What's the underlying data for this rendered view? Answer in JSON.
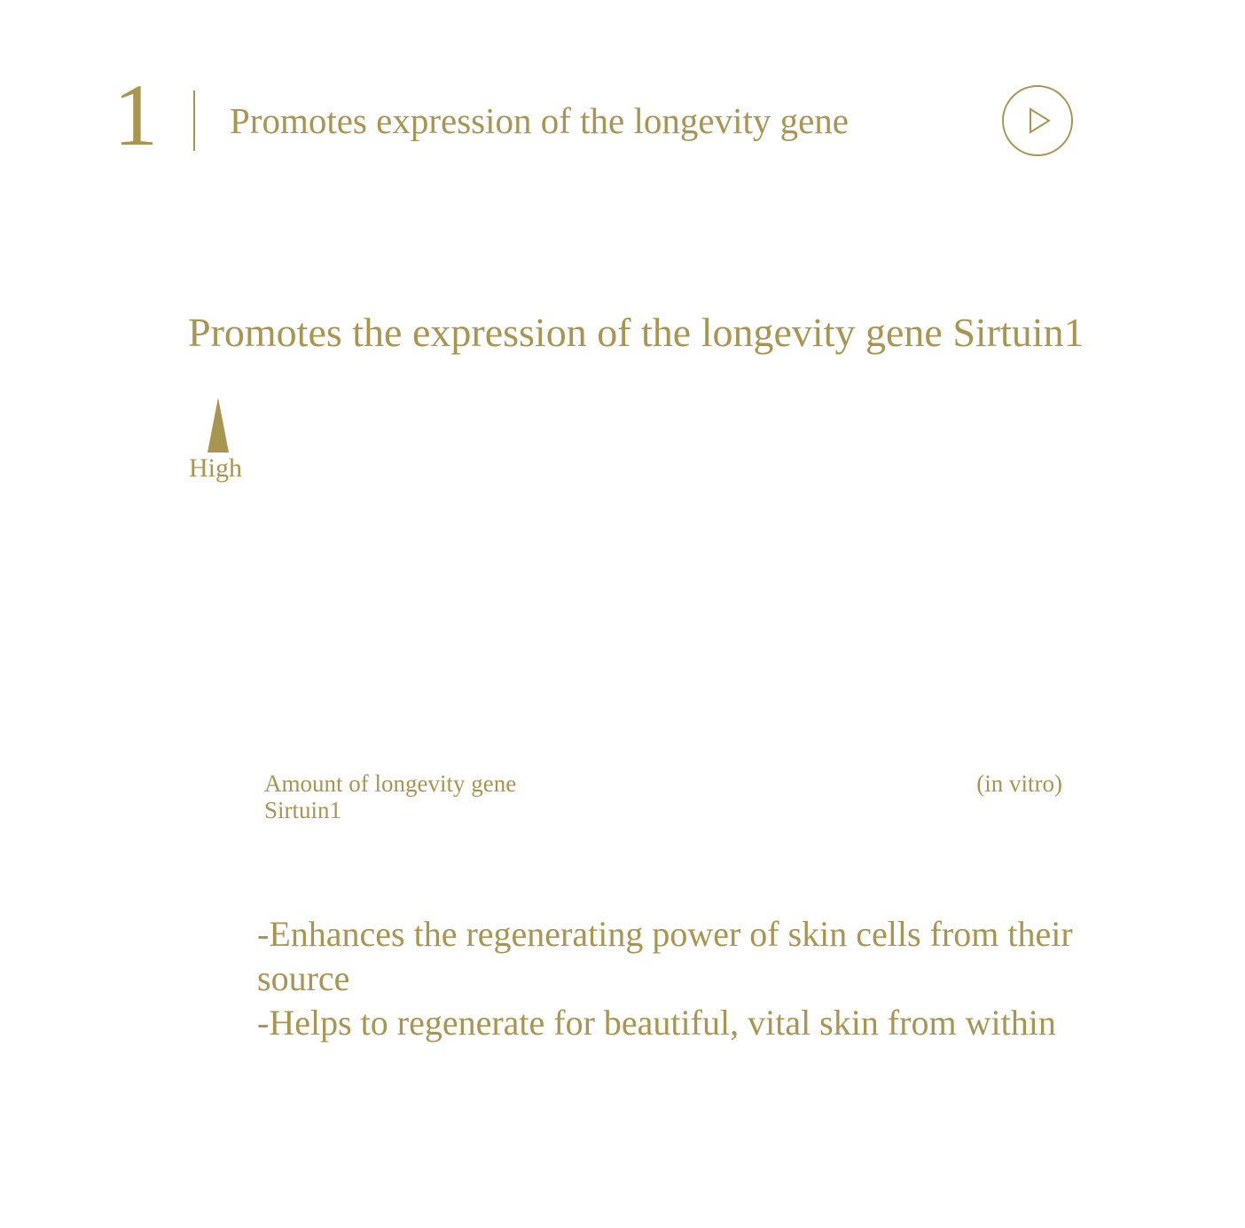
{
  "header": {
    "step_number": "1",
    "title": "Promotes expression of the longevity gene",
    "play_icon": "play-icon"
  },
  "section": {
    "title": "Promotes the expression of the longevity gene Sirtuin1"
  },
  "chart": {
    "high_label": "High",
    "arrow_icon": "up-arrow-icon",
    "amount_label_line1": "Amount of longevity gene",
    "amount_label_line2": "Sirtuin1",
    "note": "(in vitro)"
  },
  "benefits": [
    "-Enhances the regenerating power of skin cells from their source",
    "-Helps to regenerate for beautiful, vital skin from within"
  ],
  "colors": {
    "accent": "#a89550",
    "background": "#ffffff"
  }
}
